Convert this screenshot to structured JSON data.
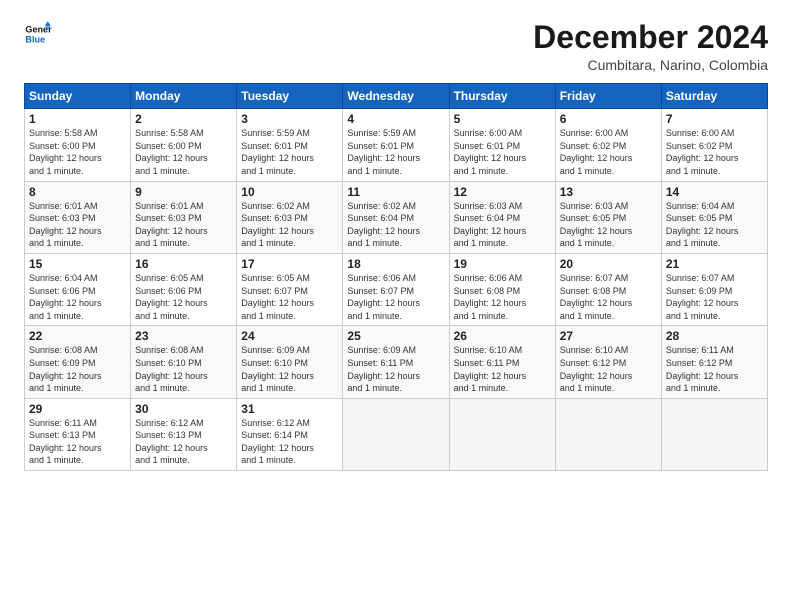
{
  "logo": {
    "line1": "General",
    "line2": "Blue"
  },
  "title": "December 2024",
  "subtitle": "Cumbitara, Narino, Colombia",
  "days_of_week": [
    "Sunday",
    "Monday",
    "Tuesday",
    "Wednesday",
    "Thursday",
    "Friday",
    "Saturday"
  ],
  "weeks": [
    [
      {
        "day": "1",
        "sunrise": "5:58 AM",
        "sunset": "6:00 PM",
        "daylight": "12 hours and 1 minute."
      },
      {
        "day": "2",
        "sunrise": "5:58 AM",
        "sunset": "6:00 PM",
        "daylight": "12 hours and 1 minute."
      },
      {
        "day": "3",
        "sunrise": "5:59 AM",
        "sunset": "6:01 PM",
        "daylight": "12 hours and 1 minute."
      },
      {
        "day": "4",
        "sunrise": "5:59 AM",
        "sunset": "6:01 PM",
        "daylight": "12 hours and 1 minute."
      },
      {
        "day": "5",
        "sunrise": "6:00 AM",
        "sunset": "6:01 PM",
        "daylight": "12 hours and 1 minute."
      },
      {
        "day": "6",
        "sunrise": "6:00 AM",
        "sunset": "6:02 PM",
        "daylight": "12 hours and 1 minute."
      },
      {
        "day": "7",
        "sunrise": "6:00 AM",
        "sunset": "6:02 PM",
        "daylight": "12 hours and 1 minute."
      }
    ],
    [
      {
        "day": "8",
        "sunrise": "6:01 AM",
        "sunset": "6:03 PM",
        "daylight": "12 hours and 1 minute."
      },
      {
        "day": "9",
        "sunrise": "6:01 AM",
        "sunset": "6:03 PM",
        "daylight": "12 hours and 1 minute."
      },
      {
        "day": "10",
        "sunrise": "6:02 AM",
        "sunset": "6:03 PM",
        "daylight": "12 hours and 1 minute."
      },
      {
        "day": "11",
        "sunrise": "6:02 AM",
        "sunset": "6:04 PM",
        "daylight": "12 hours and 1 minute."
      },
      {
        "day": "12",
        "sunrise": "6:03 AM",
        "sunset": "6:04 PM",
        "daylight": "12 hours and 1 minute."
      },
      {
        "day": "13",
        "sunrise": "6:03 AM",
        "sunset": "6:05 PM",
        "daylight": "12 hours and 1 minute."
      },
      {
        "day": "14",
        "sunrise": "6:04 AM",
        "sunset": "6:05 PM",
        "daylight": "12 hours and 1 minute."
      }
    ],
    [
      {
        "day": "15",
        "sunrise": "6:04 AM",
        "sunset": "6:06 PM",
        "daylight": "12 hours and 1 minute."
      },
      {
        "day": "16",
        "sunrise": "6:05 AM",
        "sunset": "6:06 PM",
        "daylight": "12 hours and 1 minute."
      },
      {
        "day": "17",
        "sunrise": "6:05 AM",
        "sunset": "6:07 PM",
        "daylight": "12 hours and 1 minute."
      },
      {
        "day": "18",
        "sunrise": "6:06 AM",
        "sunset": "6:07 PM",
        "daylight": "12 hours and 1 minute."
      },
      {
        "day": "19",
        "sunrise": "6:06 AM",
        "sunset": "6:08 PM",
        "daylight": "12 hours and 1 minute."
      },
      {
        "day": "20",
        "sunrise": "6:07 AM",
        "sunset": "6:08 PM",
        "daylight": "12 hours and 1 minute."
      },
      {
        "day": "21",
        "sunrise": "6:07 AM",
        "sunset": "6:09 PM",
        "daylight": "12 hours and 1 minute."
      }
    ],
    [
      {
        "day": "22",
        "sunrise": "6:08 AM",
        "sunset": "6:09 PM",
        "daylight": "12 hours and 1 minute."
      },
      {
        "day": "23",
        "sunrise": "6:08 AM",
        "sunset": "6:10 PM",
        "daylight": "12 hours and 1 minute."
      },
      {
        "day": "24",
        "sunrise": "6:09 AM",
        "sunset": "6:10 PM",
        "daylight": "12 hours and 1 minute."
      },
      {
        "day": "25",
        "sunrise": "6:09 AM",
        "sunset": "6:11 PM",
        "daylight": "12 hours and 1 minute."
      },
      {
        "day": "26",
        "sunrise": "6:10 AM",
        "sunset": "6:11 PM",
        "daylight": "12 hours and 1 minute."
      },
      {
        "day": "27",
        "sunrise": "6:10 AM",
        "sunset": "6:12 PM",
        "daylight": "12 hours and 1 minute."
      },
      {
        "day": "28",
        "sunrise": "6:11 AM",
        "sunset": "6:12 PM",
        "daylight": "12 hours and 1 minute."
      }
    ],
    [
      {
        "day": "29",
        "sunrise": "6:11 AM",
        "sunset": "6:13 PM",
        "daylight": "12 hours and 1 minute."
      },
      {
        "day": "30",
        "sunrise": "6:12 AM",
        "sunset": "6:13 PM",
        "daylight": "12 hours and 1 minute."
      },
      {
        "day": "31",
        "sunrise": "6:12 AM",
        "sunset": "6:14 PM",
        "daylight": "12 hours and 1 minute."
      },
      null,
      null,
      null,
      null
    ]
  ],
  "labels": {
    "sunrise": "Sunrise:",
    "sunset": "Sunset:",
    "daylight": "Daylight:"
  }
}
